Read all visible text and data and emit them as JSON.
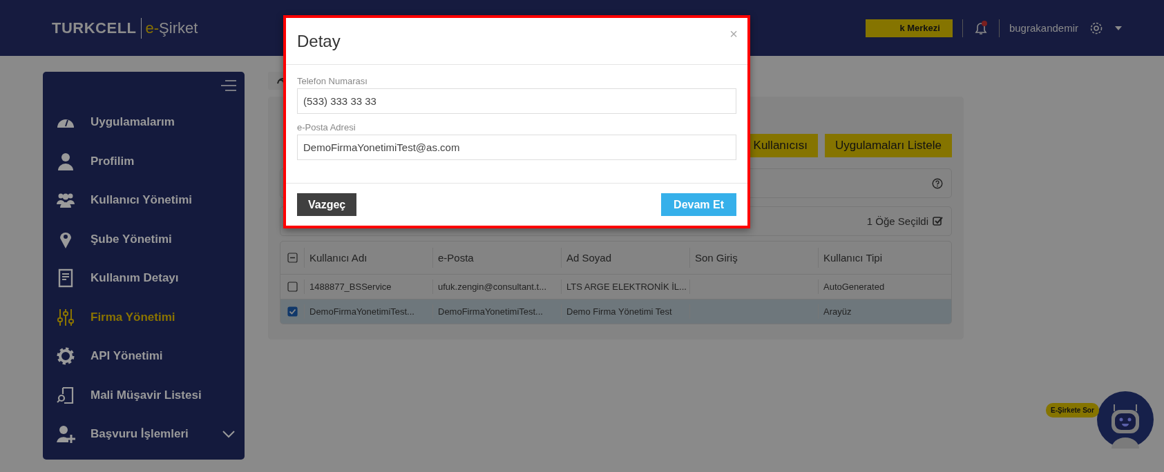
{
  "header": {
    "logo_brand": "TURKCELL",
    "logo_prefix": "e-",
    "logo_name": "Şirket",
    "help_button": "k Merkezi",
    "notification_unread": true,
    "username": "bugrakandemir"
  },
  "sidebar": {
    "items": [
      {
        "label": "Uygulamalarım",
        "selected": false
      },
      {
        "label": "Profilim",
        "selected": false
      },
      {
        "label": "Kullanıcı Yönetimi",
        "selected": false
      },
      {
        "label": "Şube Yönetimi",
        "selected": false
      },
      {
        "label": "Kullanım Detayı",
        "selected": false
      },
      {
        "label": "Firma Yönetimi",
        "selected": true
      },
      {
        "label": "API Yönetimi",
        "selected": false
      },
      {
        "label": "Mali Müşavir Listesi",
        "selected": false
      },
      {
        "label": "Başvuru İşlemleri",
        "selected": false,
        "expanded": false
      }
    ]
  },
  "content": {
    "buttons": [
      "Kullanıcısı",
      "Uygulamaları Listele"
    ],
    "selection_summary": "1 Öğe Seçildi",
    "table": {
      "header_indeterminate": true,
      "columns": [
        "Kullanıcı Adı",
        "e-Posta",
        "Ad Soyad",
        "Son Giriş",
        "Kullanıcı Tipi"
      ],
      "rows": [
        {
          "selected": false,
          "cells": [
            "1488877_BSService",
            "ufuk.zengin@consultant.t...",
            "LTS ARGE ELEKTRONİK İL...",
            "",
            "AutoGenerated"
          ]
        },
        {
          "selected": true,
          "cells": [
            "DemoFirmaYonetimiTest...",
            "DemoFirmaYonetimiTest...",
            "Demo Firma Yönetimi Test",
            "",
            "Arayüz"
          ]
        }
      ]
    }
  },
  "assistant": {
    "bubble": "E-Şirkete Sor"
  },
  "dialog": {
    "title": "Detay",
    "close": "×",
    "fields": [
      {
        "label": "Telefon Numarası",
        "value": "(533) 333 33 33"
      },
      {
        "label": "e-Posta Adresi",
        "value": "DemoFirmaYonetimiTest@as.com"
      }
    ],
    "buttons": [
      {
        "label": "Vazgeç",
        "kind": "cancel"
      },
      {
        "label": "Devam Et",
        "kind": "confirm"
      }
    ]
  }
}
